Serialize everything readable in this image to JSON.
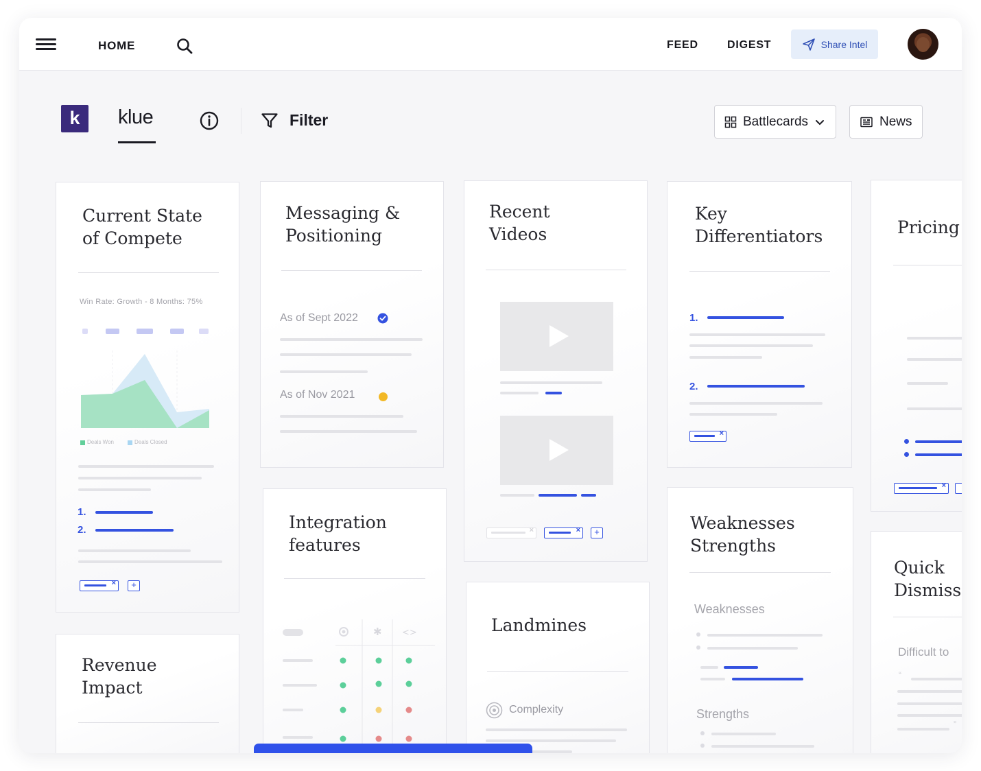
{
  "topbar": {
    "home_label": "HOME",
    "feed_label": "FEED",
    "digest_label": "DIGEST",
    "share_label": "Share Intel",
    "icons": [
      "menu-icon",
      "search-icon",
      "paper-plane-icon",
      "avatar"
    ]
  },
  "toolbar": {
    "logo_letter": "k",
    "brand": "klue",
    "filter_label": "Filter",
    "battlecards_label": "Battlecards",
    "news_label": "News",
    "icons": [
      "info-icon",
      "filter-icon",
      "grid-icon",
      "chevron-down-icon",
      "newspaper-icon"
    ]
  },
  "colors": {
    "accent": "#3452e0",
    "logo_bg": "#3a2a7c",
    "share_bg": "#e6eefa",
    "green": "#5ccf9a",
    "amber": "#f2b825",
    "red": "#e58a8a"
  },
  "cards": {
    "current_state": {
      "title": "Current State\nof Compete",
      "chart_caption": "Win Rate: Growth - 8 Months: 75%",
      "legend_won": "Deals Won",
      "legend_closed": "Deals Closed",
      "num1": "1.",
      "num2": "2."
    },
    "messaging": {
      "title": "Messaging &\nPositioning",
      "version_1": "As of Sept 2022",
      "version_2": "As of Nov 2021"
    },
    "recent_videos": {
      "title": "Recent\nVideos"
    },
    "key_diff": {
      "title": "Key\nDifferentiators",
      "num1": "1.",
      "num2": "2."
    },
    "pricing": {
      "title": "Pricing"
    },
    "integration": {
      "title": "Integration\nfeatures"
    },
    "landmines": {
      "title": "Landmines",
      "complexity_label": "Complexity"
    },
    "weak_strong": {
      "title": "Weaknesses\nStrengths",
      "weaknesses_label": "Weaknesses",
      "strengths_label": "Strengths"
    },
    "quick_dismiss": {
      "title": "Quick\nDismiss",
      "difficult_label": "Difficult to"
    },
    "revenue": {
      "title": "Revenue\nImpact"
    }
  }
}
